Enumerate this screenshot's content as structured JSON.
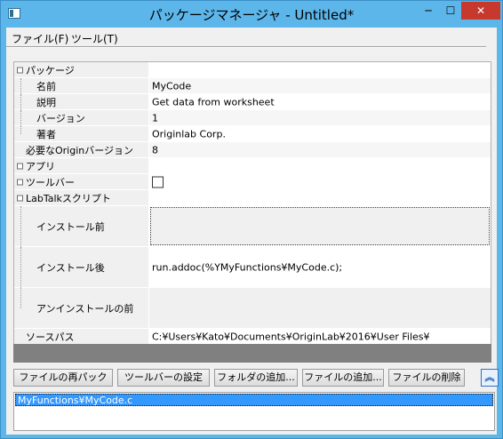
{
  "window": {
    "title": "パッケージマネージャ - Untitled*",
    "min_glyph": "─",
    "max_glyph": "☐",
    "close_glyph": "✕"
  },
  "menu": [
    "ファイル(F)",
    "ツール(T)"
  ],
  "grid": {
    "rows": [
      {
        "name": "パッケージ",
        "value": ""
      },
      {
        "name": "名前",
        "value": "MyCode"
      },
      {
        "name": "説明",
        "value": "Get data from worksheet"
      },
      {
        "name": "バージョン",
        "value": "1"
      },
      {
        "name": "著者",
        "value": "Originlab Corp."
      },
      {
        "name": "必要なOriginバージョン",
        "value": "8"
      },
      {
        "name": "アプリ",
        "value": ""
      },
      {
        "name": "ツールバー",
        "value": ""
      },
      {
        "name": "LabTalkスクリプト",
        "value": ""
      },
      {
        "name": "インストール前",
        "value": ""
      },
      {
        "name": "インストール後",
        "value": "run.addoc(%YMyFunctions¥MyCode.c);"
      },
      {
        "name": "アンインストールの前",
        "value": ""
      },
      {
        "name": "ソースパス",
        "value": "C:¥Users¥Kato¥Documents¥OriginLab¥2016¥User Files¥"
      }
    ],
    "toolbar_checked": false
  },
  "buttons": {
    "repack": "ファイルの再パック",
    "toolbar_settings": "ツールバーの設定",
    "add_folder": "フォルダの追加...",
    "add_file": "ファイルの追加...",
    "delete_file": "ファイルの削除",
    "collapse_glyph": "︽"
  },
  "file_list": [
    "MyFunctions¥MyCode.c"
  ],
  "colors": {
    "titlebar": "#5db6ea",
    "close_button": "#c7392d",
    "selection": "#3399ff"
  }
}
